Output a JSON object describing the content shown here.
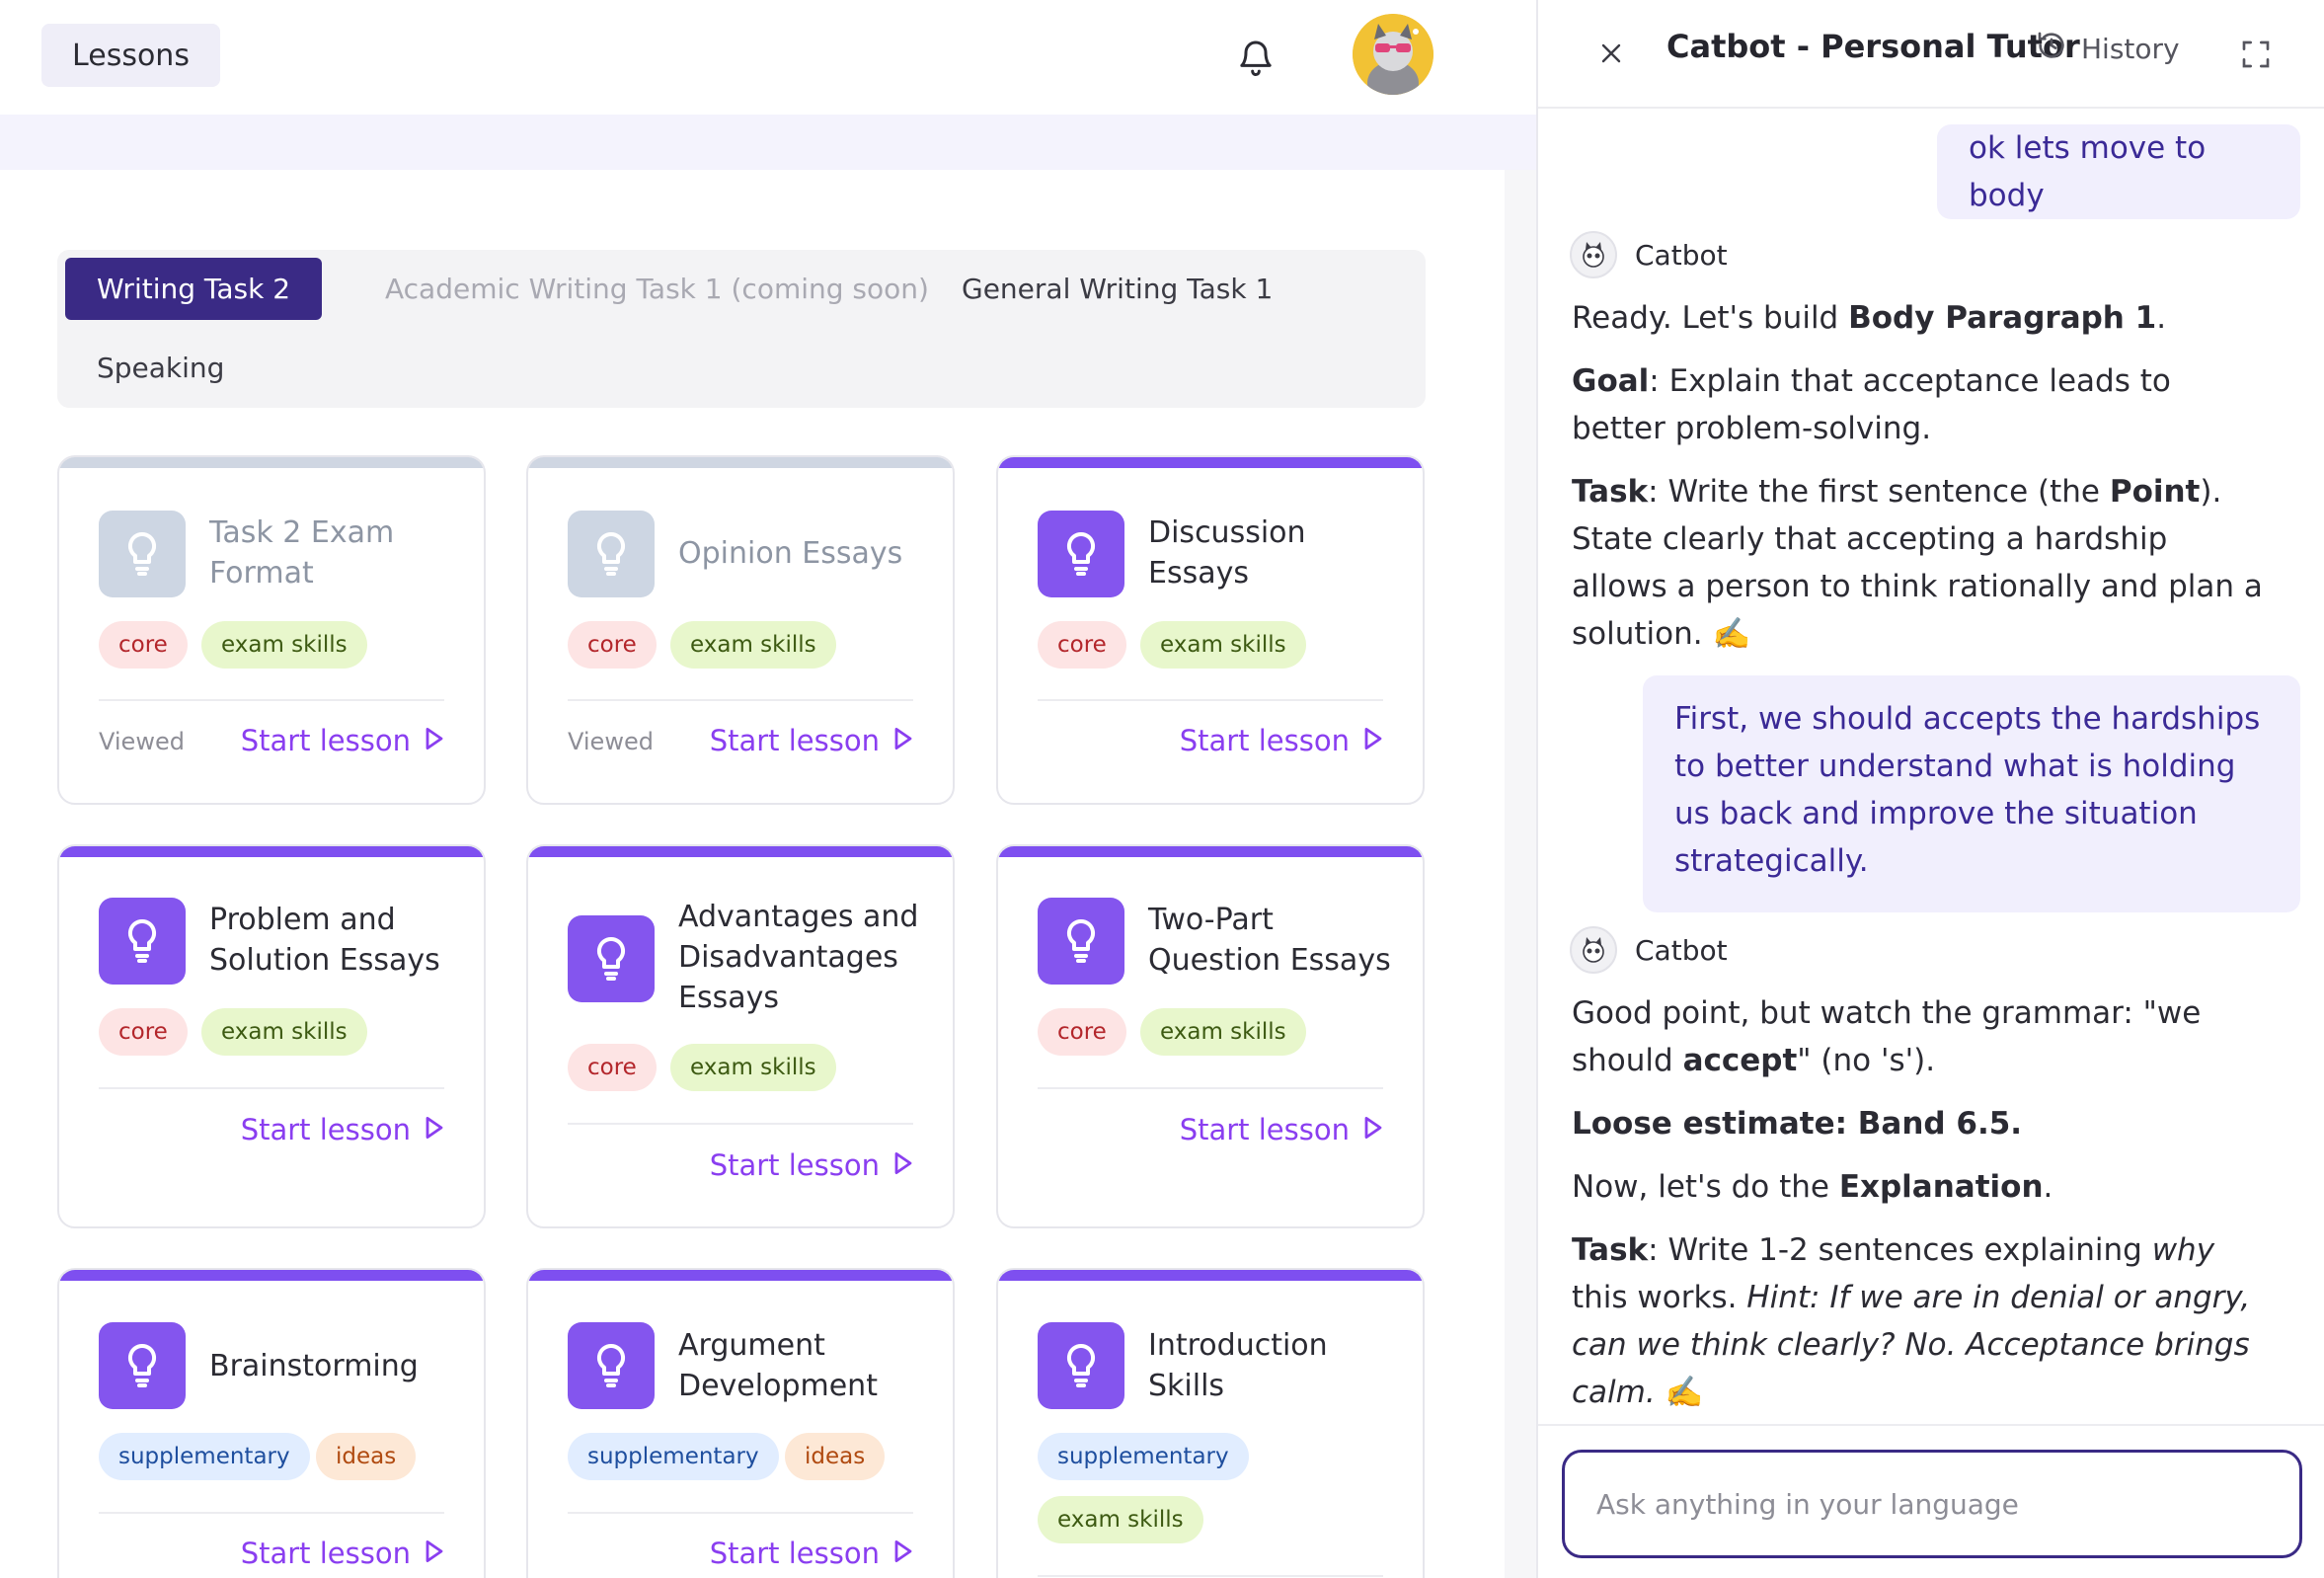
{
  "header": {
    "lessons_label": "Lessons"
  },
  "tabs": [
    {
      "label": "Writing Task 2",
      "state": "active"
    },
    {
      "label": "Academic Writing Task 1 (coming soon)",
      "state": "disabled"
    },
    {
      "label": "General Writing Task 1",
      "state": "normal"
    },
    {
      "label": "Speaking",
      "state": "normal"
    }
  ],
  "cards": [
    {
      "title": "Task 2 Exam Format",
      "tags": [
        "core",
        "exam skills"
      ],
      "status": "Viewed",
      "action": "Start lesson"
    },
    {
      "title": "Opinion Essays",
      "tags": [
        "core",
        "exam skills"
      ],
      "status": "Viewed",
      "action": "Start lesson"
    },
    {
      "title": "Discussion Essays",
      "tags": [
        "core",
        "exam skills"
      ],
      "status": "",
      "action": "Start lesson"
    },
    {
      "title": "Problem and Solution Essays",
      "tags": [
        "core",
        "exam skills"
      ],
      "status": "",
      "action": "Start lesson"
    },
    {
      "title": "Advantages and Disadvantages Essays",
      "tags": [
        "core",
        "exam skills"
      ],
      "status": "",
      "action": "Start lesson"
    },
    {
      "title": "Two-Part Question Essays",
      "tags": [
        "core",
        "exam skills"
      ],
      "status": "",
      "action": "Start lesson"
    },
    {
      "title": "Brainstorming",
      "tags": [
        "supplementary",
        "ideas"
      ],
      "status": "",
      "action": "Start lesson"
    },
    {
      "title": "Argument Development",
      "tags": [
        "supplementary",
        "ideas"
      ],
      "status": "",
      "action": "Start lesson"
    },
    {
      "title": "Introduction Skills",
      "tags": [
        "supplementary",
        "exam skills"
      ],
      "status": "",
      "action": "Start lesson"
    }
  ],
  "panel": {
    "title": "Catbot - Personal Tutor",
    "history_label": "History",
    "bot_name": "Catbot",
    "input_placeholder": "Ask anything in your language"
  },
  "chat": {
    "user_1": "ok lets move to body",
    "bot_1": {
      "p1_a": "Ready. Let's build ",
      "p1_b": "Body Paragraph 1",
      "p1_c": ".",
      "p2_a": "Goal",
      "p2_b": ": Explain that acceptance leads to better problem-solving.",
      "p3_a": "Task",
      "p3_b": ": Write the first sentence (the ",
      "p3_c": "Point",
      "p3_d": "). State clearly that accepting a hardship allows a person to think rationally and plan a solution. ✍️"
    },
    "user_2": "First, we should accepts the hardships to better understand what is holding us back and improve the situation strategically.",
    "bot_2": {
      "p1_a": "Good point, but watch the grammar: \"we should ",
      "p1_b": "accept",
      "p1_c": "\" (no 's').",
      "p2": "Loose estimate: Band 6.5.",
      "p3_a": "Now, let's do the ",
      "p3_b": "Explanation",
      "p3_c": ".",
      "p4_a": "Task",
      "p4_b": ": Write 1-2 sentences explaining ",
      "p4_c": "why",
      "p4_d": " this works. ",
      "p4_e": "Hint: If we are in denial or angry, can we think clearly? No. Acceptance brings calm.",
      "p4_f": " ✍️"
    }
  },
  "colors": {
    "accent": "#8a3ef0",
    "brand_dark": "#3a2a85",
    "icon_purple": "#8455ee",
    "viewed_gray": "#cdd6e3"
  }
}
